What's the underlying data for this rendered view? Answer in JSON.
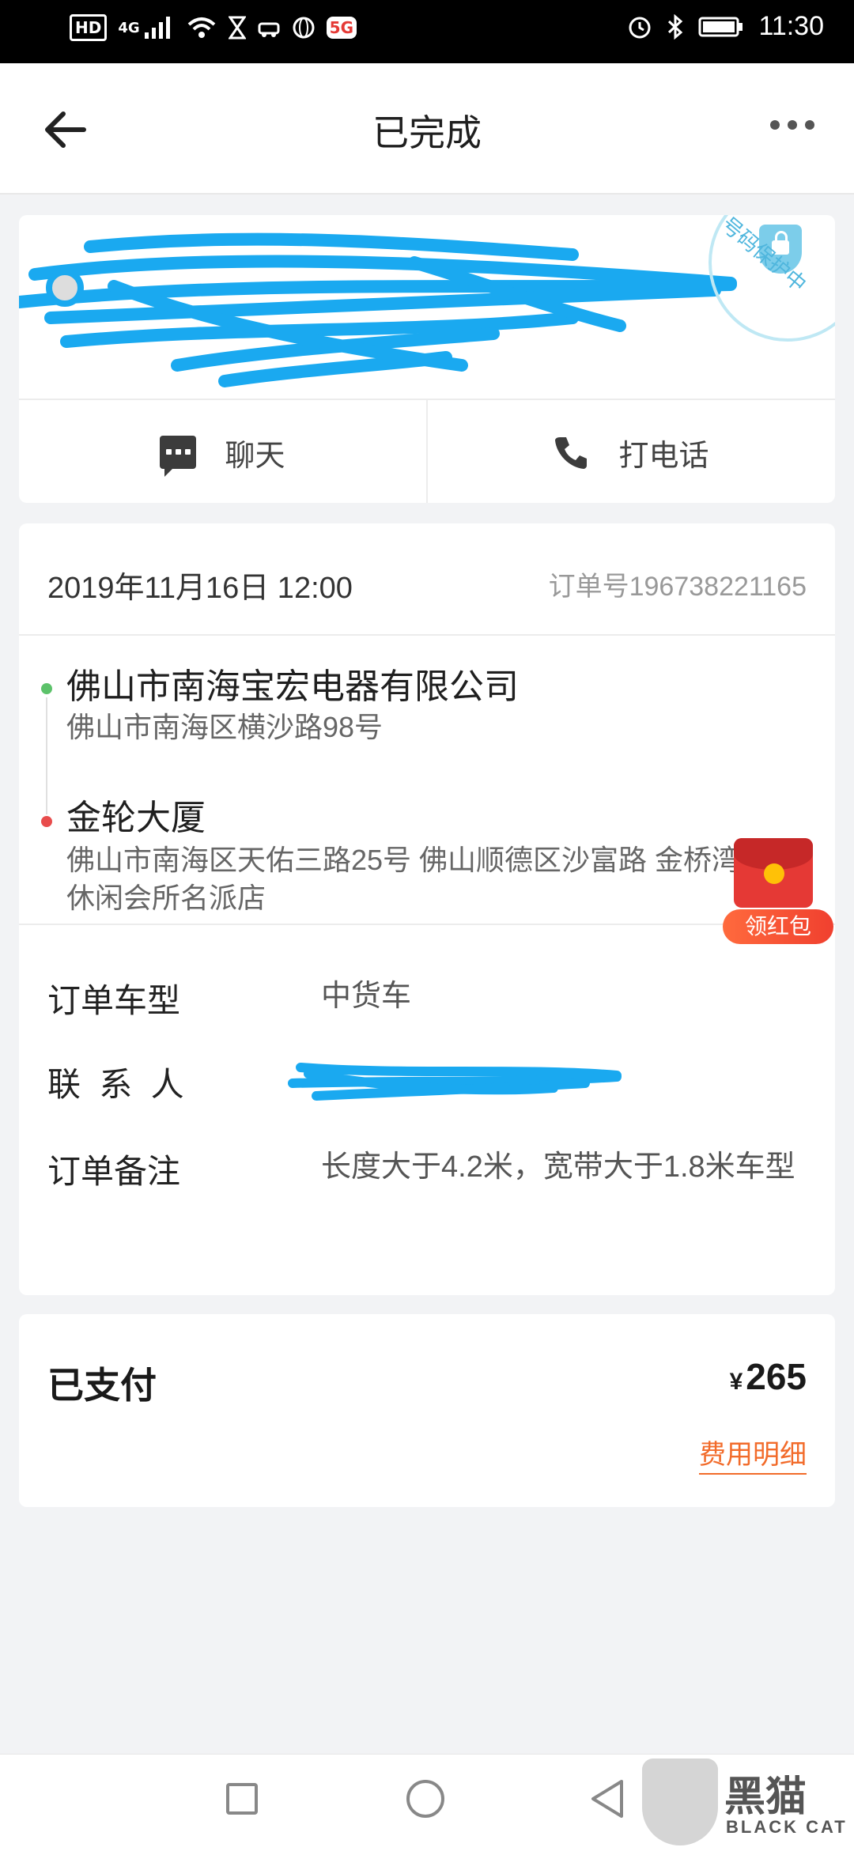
{
  "status_bar": {
    "hd": "HD",
    "network": "4G",
    "g5": "5G",
    "time": "11:30"
  },
  "header": {
    "title": "已完成"
  },
  "driver": {
    "privacy_badge": "号码保护中",
    "chat_label": "聊天",
    "call_label": "打电话"
  },
  "order": {
    "datetime": "2019年11月16日 12:00",
    "order_no": "订单号196738221165",
    "pickup": {
      "name": "佛山市南海宝宏电器有限公司",
      "address": "佛山市南海区横沙路98号"
    },
    "dropoff": {
      "name": "金轮大厦",
      "address": "佛山市南海区天佑三路25号 佛山顺德区沙富路 金桥湾休闲会所名派店"
    },
    "red_packet_label": "领红包",
    "vehicle_type_label": "订单车型",
    "vehicle_type_value": "中货车",
    "contact_label": "联  系  人",
    "remark_label": "订单备注",
    "remark_value": "长度大于4.2米，宽带大于1.8米车型"
  },
  "payment": {
    "label": "已支付",
    "currency": "¥",
    "amount": "265",
    "fee_detail_link": "费用明细"
  },
  "watermark": {
    "brand": "黑猫",
    "brand_en": "BLACK CAT"
  },
  "colors": {
    "accent": "#f26b2a",
    "pickup_dot": "#5cc26a",
    "dropoff_dot": "#e84c4c",
    "scribble": "#1aa9f0"
  }
}
